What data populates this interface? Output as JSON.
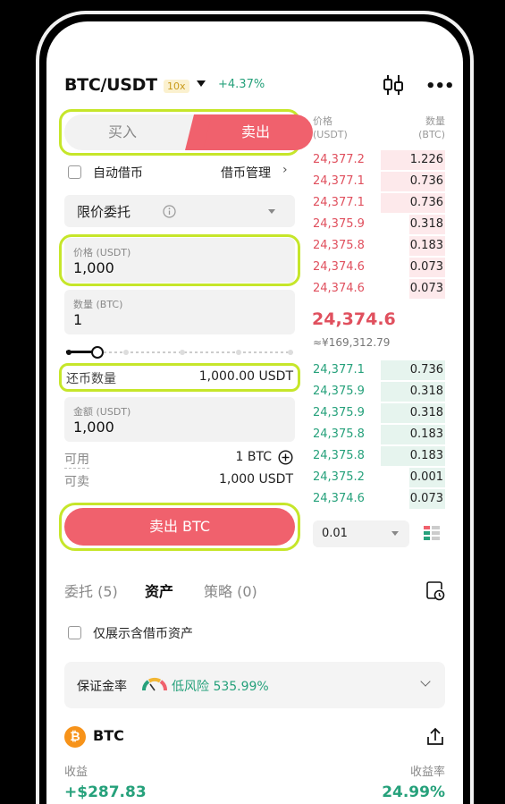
{
  "header": {
    "pair": "BTC/USDT",
    "leverage": "10x",
    "change": "+4.37%",
    "chart_icon": "candlestick-icon",
    "more_icon": "more-dots-icon"
  },
  "trade_form": {
    "buy_label": "买入",
    "sell_label": "卖出",
    "auto_borrow_label": "自动借币",
    "borrow_manage_label": "借币管理",
    "order_type": "限价委托",
    "price_label": "价格 (USDT)",
    "price_value": "1,000",
    "qty_label": "数量 (BTC)",
    "qty_value": "1",
    "repay_label": "还币数量",
    "repay_value": "1,000.00 USDT",
    "amount_label": "金额 (USDT)",
    "amount_value": "1,000",
    "available_label": "可用",
    "available_value": "1 BTC",
    "sellable_label": "可卖",
    "sellable_value": "1,000 USDT",
    "submit_label": "卖出 BTC"
  },
  "order_book": {
    "price_header": "价格",
    "price_unit": "(USDT)",
    "qty_header": "数量",
    "qty_unit": "(BTC)",
    "asks": [
      {
        "price": "24,377.2",
        "qty": "1.226"
      },
      {
        "price": "24,377.1",
        "qty": "0.736"
      },
      {
        "price": "24,377.1",
        "qty": "0.736"
      },
      {
        "price": "24,375.9",
        "qty": "0.318"
      },
      {
        "price": "24,375.8",
        "qty": "0.183"
      },
      {
        "price": "24,374.6",
        "qty": "0.073"
      },
      {
        "price": "24,374.6",
        "qty": "0.073"
      }
    ],
    "last_price": "24,374.6",
    "last_fiat": "≈¥169,312.79",
    "bids": [
      {
        "price": "24,377.1",
        "qty": "0.736"
      },
      {
        "price": "24,375.9",
        "qty": "0.318"
      },
      {
        "price": "24,375.9",
        "qty": "0.318"
      },
      {
        "price": "24,375.8",
        "qty": "0.183"
      },
      {
        "price": "24,375.8",
        "qty": "0.183"
      },
      {
        "price": "24,375.2",
        "qty": "0.001"
      },
      {
        "price": "24,374.6",
        "qty": "0.073"
      }
    ],
    "tick_size": "0.01"
  },
  "tabs": {
    "orders": "委托 (5)",
    "assets": "资产",
    "strategy": "策略 (0)"
  },
  "assets": {
    "show_borrowed_label": "仅展示含借币资产",
    "margin_label": "保证金率",
    "risk_text": "低风险 535.99%",
    "coin": "BTC",
    "coin_badge": "₿",
    "pnl_label": "收益",
    "pnl_value": "+$287.83",
    "pnl_rate_label": "收益率",
    "pnl_rate_value": "24.99%"
  },
  "colors": {
    "sell": "#f0616d",
    "buy": "#26a17b",
    "highlight": "#c6e62a"
  }
}
